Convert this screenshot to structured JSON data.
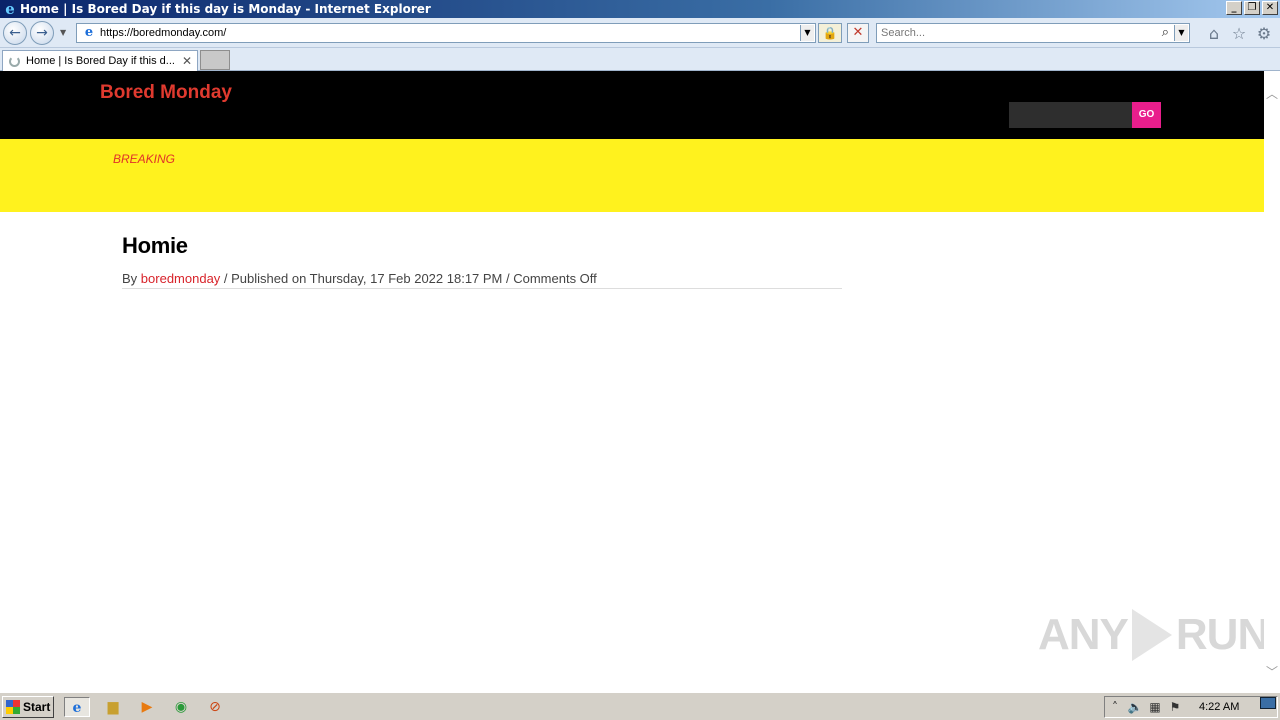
{
  "window": {
    "title": "Home | Is Bored Day if this day is Monday - Internet Explorer",
    "minimize": "_",
    "restore": "❐",
    "close": "✕"
  },
  "nav": {
    "url": "https://boredmonday.com/",
    "search_placeholder": "Search..."
  },
  "tabs": [
    {
      "label": "Home | Is Bored Day if this d..."
    }
  ],
  "site": {
    "title": "Bored Monday",
    "search_button": "GO",
    "breaking_label": "BREAKING"
  },
  "post": {
    "title": "Homie",
    "meta_by": "By ",
    "author": "boredmonday",
    "meta_rest": " / Published on Thursday, 17 Feb 2022 18:17 PM / Comments Off"
  },
  "watermark": {
    "left": "ANY",
    "right": "RUN"
  },
  "taskbar": {
    "start_label": "Start",
    "clock": "4:22 AM"
  },
  "colors": {
    "header_bg": "#000000",
    "site_title": "#e03a2f",
    "go_button": "#e91e8c",
    "breaking_bg": "#fff21e",
    "author_link": "#d8232a"
  }
}
